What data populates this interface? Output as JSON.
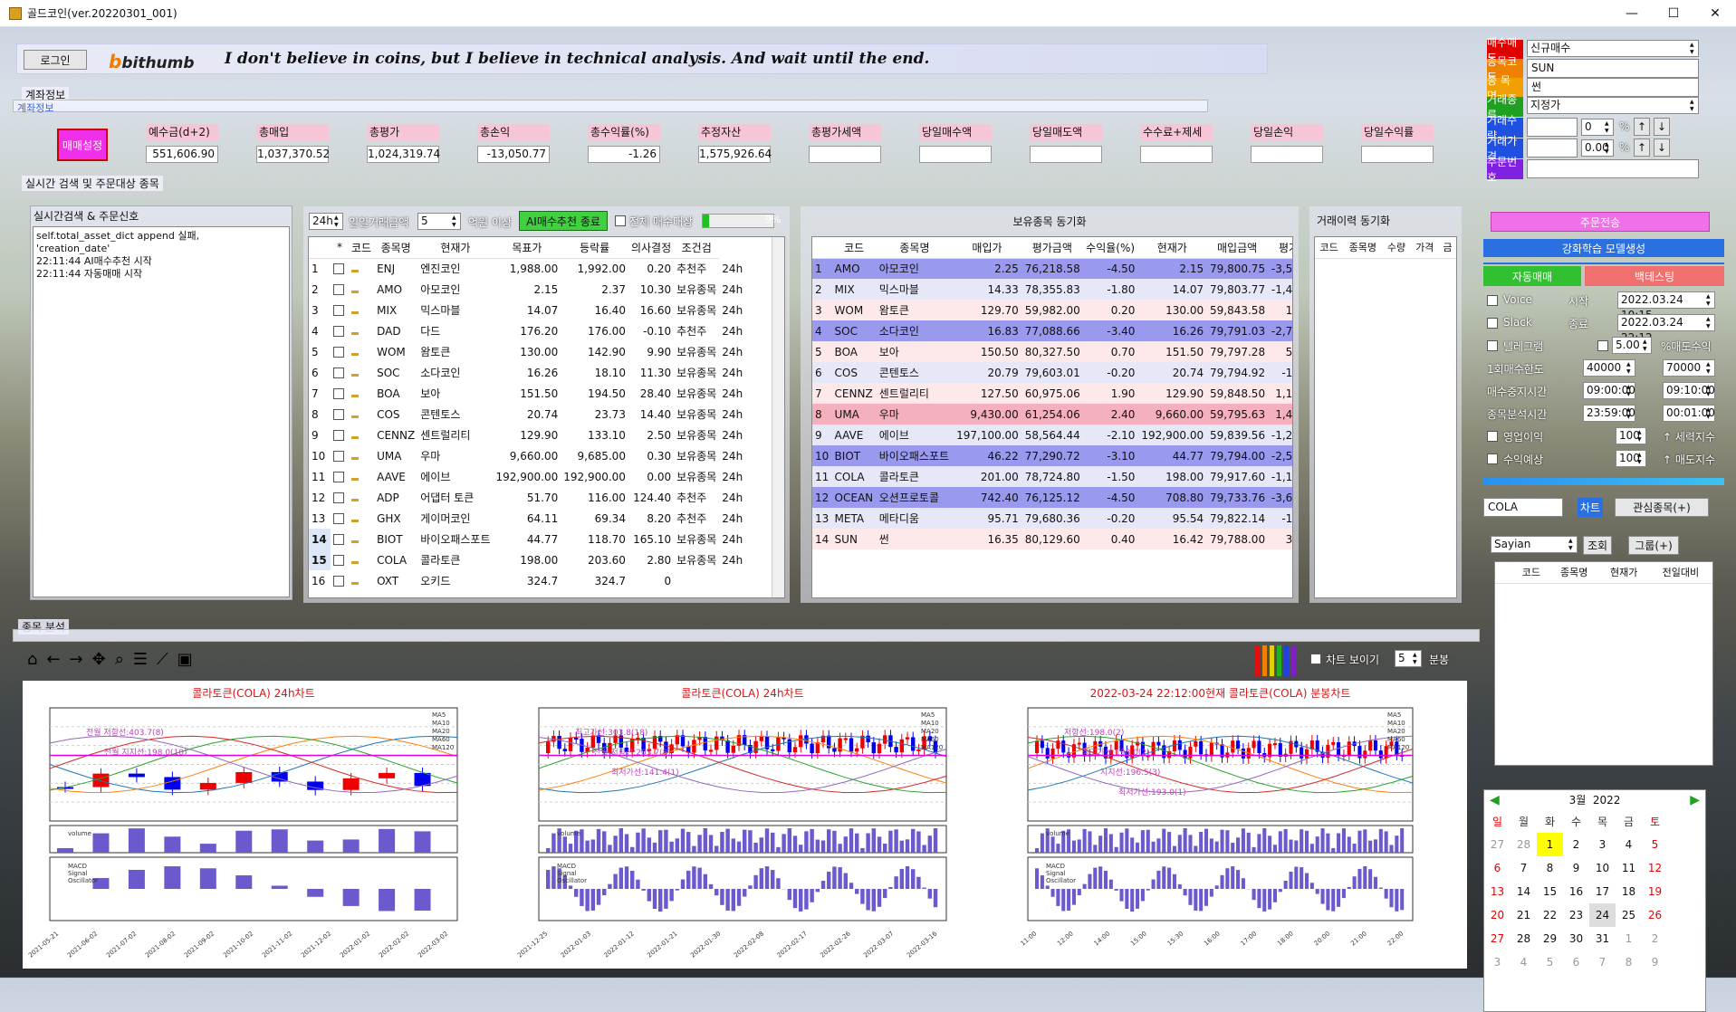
{
  "window": {
    "title": "골드코인(ver.20220301_001)",
    "min": "—",
    "max": "☐",
    "close": "✕"
  },
  "top": {
    "login": "로그인",
    "brand": "bithumb",
    "motto": "I don't believe in coins, but I believe in technical analysis. And wait until the end."
  },
  "account": {
    "section": "계좌정보",
    "section2": "계좌정보",
    "setting_btn": "매매설정",
    "labels": [
      "예수금(d+2)",
      "총매입",
      "총평가",
      "총손익",
      "총수익률(%)",
      "추정자산",
      "총평가세액",
      "당일매수액",
      "당일매도액",
      "수수료+제세",
      "당일손익",
      "당일수익률"
    ],
    "values": [
      "551,606.90",
      "1,037,370.52",
      "1,024,319.74",
      "-13,050.77",
      "-1.26",
      "1,575,926.64",
      "",
      "",
      "",
      "",
      "",
      ""
    ]
  },
  "search_section": "실시간 검색 및 주문대상 종목",
  "signal": {
    "title": "실시간검색 & 주문신호",
    "lines": [
      "self.total_asset_dict append 실패,",
      "'creation_date'",
      "22:11:44 AI매수추천 시작",
      "22:11:44 자동매매 시작"
    ]
  },
  "scan": {
    "period": "24h",
    "vol_label": "일일거래금액",
    "vol_value": "5",
    "unit": "억원 이상",
    "ai_btn": "AI매수추천 종료",
    "all_buy": "전체 매수대상",
    "progress": "9%",
    "headers": [
      "",
      "*",
      "코드",
      "종목명",
      "현재가",
      "목표가",
      "등락률",
      "의사결정",
      "조건검"
    ],
    "rows": [
      [
        "1",
        "ENJ",
        "엔진코인",
        "1,988.00",
        "1,992.00",
        "0.20",
        "추천주",
        "24h"
      ],
      [
        "2",
        "AMO",
        "아모코인",
        "2.15",
        "2.37",
        "10.30",
        "보유종목",
        "24h"
      ],
      [
        "3",
        "MIX",
        "믹스마블",
        "14.07",
        "16.40",
        "16.60",
        "보유종목",
        "24h"
      ],
      [
        "4",
        "DAD",
        "다드",
        "176.20",
        "176.00",
        "-0.10",
        "추천주",
        "24h"
      ],
      [
        "5",
        "WOM",
        "왐토큰",
        "130.00",
        "142.90",
        "9.90",
        "보유종목",
        "24h"
      ],
      [
        "6",
        "SOC",
        "소다코인",
        "16.26",
        "18.10",
        "11.30",
        "보유종목",
        "24h"
      ],
      [
        "7",
        "BOA",
        "보아",
        "151.50",
        "194.50",
        "28.40",
        "보유종목",
        "24h"
      ],
      [
        "8",
        "COS",
        "콘텐토스",
        "20.74",
        "23.73",
        "14.40",
        "보유종목",
        "24h"
      ],
      [
        "9",
        "CENNZ",
        "센트럴리티",
        "129.90",
        "133.10",
        "2.50",
        "보유종목",
        "24h"
      ],
      [
        "10",
        "UMA",
        "우마",
        "9,660.00",
        "9,685.00",
        "0.30",
        "보유종목",
        "24h"
      ],
      [
        "11",
        "AAVE",
        "에이브",
        "192,900.00",
        "192,900.00",
        "0.00",
        "보유종목",
        "24h"
      ],
      [
        "12",
        "ADP",
        "어댑터 토큰",
        "51.70",
        "116.00",
        "124.40",
        "추천주",
        "24h"
      ],
      [
        "13",
        "GHX",
        "게이머코인",
        "64.11",
        "69.34",
        "8.20",
        "추천주",
        "24h"
      ],
      [
        "14",
        "BIOT",
        "바이오패스포트",
        "44.77",
        "118.70",
        "165.10",
        "보유종목",
        "24h"
      ],
      [
        "15",
        "COLA",
        "콜라토큰",
        "198.00",
        "203.60",
        "2.80",
        "보유종목",
        "24h"
      ],
      [
        "16",
        "OXT",
        "오키드",
        "324.7",
        "324.7",
        "0",
        "",
        " "
      ]
    ]
  },
  "holdings": {
    "title": "보유종목 동기화",
    "headers": [
      "",
      "코드",
      "종목명",
      "매입가",
      "평가금액",
      "수익율(%)",
      "현재가",
      "매입금액",
      "평가손"
    ],
    "rows": [
      [
        "1",
        "AMO",
        "아모코인",
        "2.25",
        "76,218.58",
        "-4.50",
        "2.15",
        "79,800.75",
        "-3,582.1",
        "b"
      ],
      [
        "2",
        "MIX",
        "믹스마블",
        "14.33",
        "78,355.83",
        "-1.80",
        "14.07",
        "79,803.77",
        "-1,447.9",
        "l"
      ],
      [
        "3",
        "WOM",
        "왐토큰",
        "129.70",
        "59,982.00",
        "0.20",
        "130.00",
        "59,843.58",
        "138.4",
        "p"
      ],
      [
        "4",
        "SOC",
        "소다코인",
        "16.83",
        "77,088.66",
        "-3.40",
        "16.26",
        "79,791.03",
        "-2,702.3",
        "b"
      ],
      [
        "5",
        "BOA",
        "보아",
        "150.50",
        "80,327.50",
        "0.70",
        "151.50",
        "79,797.28",
        "530.2",
        "p"
      ],
      [
        "6",
        "COS",
        "콘텐토스",
        "20.79",
        "79,603.01",
        "-0.20",
        "20.74",
        "79,794.92",
        "-191.9",
        "l"
      ],
      [
        "7",
        "CENNZ",
        "센트럴리티",
        "127.50",
        "60,975.06",
        "1.90",
        "129.90",
        "59,848.50",
        "1,126.5",
        "p"
      ],
      [
        "8",
        "UMA",
        "우마",
        "9,430.00",
        "61,254.06",
        "2.40",
        "9,660.00",
        "59,795.63",
        "1,458.4",
        "k"
      ],
      [
        "9",
        "AAVE",
        "에이브",
        "197,100.00",
        "58,564.44",
        "-2.10",
        "192,900.00",
        "59,839.56",
        "-1,275.1",
        "l"
      ],
      [
        "10",
        "BIOT",
        "바이오패스포트",
        "46.22",
        "77,290.72",
        "-3.10",
        "44.77",
        "79,794.00",
        "-2,503.2",
        "b"
      ],
      [
        "11",
        "COLA",
        "콜라토큰",
        "201.00",
        "78,724.80",
        "-1.50",
        "198.00",
        "79,917.60",
        "-1,192.8",
        "l"
      ],
      [
        "12",
        "OCEAN",
        "오션프로토콜",
        "742.40",
        "76,125.12",
        "-4.50",
        "708.80",
        "79,733.76",
        "-3,608.6",
        "b"
      ],
      [
        "13",
        "META",
        "메타디움",
        "95.71",
        "79,680.36",
        "-0.20",
        "95.54",
        "79,822.14",
        "-141.7",
        "l"
      ],
      [
        "14",
        "SUN",
        "썬",
        "16.35",
        "80,129.60",
        "0.40",
        "16.42",
        "79,788.00",
        "341.6",
        "p"
      ]
    ]
  },
  "history": {
    "title": "거래이력 동기화",
    "headers": [
      "코드",
      "종목명",
      "수량",
      "가격",
      "금"
    ]
  },
  "order": {
    "labels": [
      "매수매도",
      "종목코드",
      "종 목 명",
      "거래종류",
      "거래수량",
      "거래가격",
      "주문번호"
    ],
    "label_colors": [
      "#e00000",
      "#f08000",
      "#f0a000",
      "#20a020",
      "#2050e0",
      "#2050e0",
      "#8020e0"
    ],
    "buysell": "신규매수",
    "code": "SUN",
    "name": "썬",
    "type": "지정가",
    "qty": "0",
    "price": "0.00",
    "pct": "%",
    "order_btn": "주문전송",
    "rl_btn": "강화학습 모델생성",
    "auto_btn": "자동매매",
    "backtest_btn": "백테스팅",
    "voice": "Voice",
    "start_lbl": "시작",
    "start": "2022.03.24 10:15",
    "slack": "Slack",
    "end_lbl": "종료",
    "end": "2022.03.24 22:12",
    "telegram": "텔레그램",
    "buy_pct": "5.00",
    "buy_pct_lbl": "%매도수익",
    "once_lbl": "1회매수한도",
    "once1": "40000",
    "once2": "70000",
    "stop_lbl": "매수중지시간",
    "stop1": "09:00:00",
    "stop2": "09:10:00",
    "anal_lbl": "종목분석시간",
    "anal1": "23:59:00",
    "anal2": "00:01:00",
    "biz_lbl": "영업이익",
    "biz_val": "100",
    "biz_sfx": "↑ 세력지수",
    "roe_lbl": "수익예상",
    "roe_val": "100",
    "roe_sfx": "↑ 매도지수",
    "chart_code": "COLA",
    "chart_btn": "차트",
    "fav_btn": "관심종목(+)",
    "group_sel": "Sayian",
    "query_btn": "조회",
    "group_btn": "그룹(+)",
    "fav_headers": [
      "코드",
      "종목명",
      "현재가",
      "전일대비"
    ]
  },
  "calendar": {
    "month": "3월",
    "year": "2022",
    "days": [
      "일",
      "월",
      "화",
      "수",
      "목",
      "금",
      "토"
    ],
    "weeks": [
      [
        "27",
        "28",
        "1",
        "2",
        "3",
        "4",
        "5"
      ],
      [
        "6",
        "7",
        "8",
        "9",
        "10",
        "11",
        "12"
      ],
      [
        "13",
        "14",
        "15",
        "16",
        "17",
        "18",
        "19"
      ],
      [
        "20",
        "21",
        "22",
        "23",
        "24",
        "25",
        "26"
      ],
      [
        "27",
        "28",
        "29",
        "30",
        "31",
        "1",
        "2"
      ],
      [
        "3",
        "4",
        "5",
        "6",
        "7",
        "8",
        "9"
      ]
    ]
  },
  "analysis": {
    "section": "종목 분석",
    "show_chart": "차트 보이기",
    "minutes": "5",
    "minutes_lbl": "분봉"
  },
  "chart_data": [
    {
      "type": "candlestick",
      "title": "콜라토큰(COLA) 24h차트",
      "x": [
        "2021-05-21",
        "2021-06-02",
        "2021-07-02",
        "2021-08-02",
        "2021-09-02",
        "2021-10-02",
        "2021-11-02",
        "2021-12-02",
        "2022-01-02",
        "2022-02-02",
        "2022-03-02"
      ],
      "ylim": [
        0,
        2700
      ],
      "legend": [
        "MA5",
        "MA10",
        "MA20",
        "MA60",
        "MA120"
      ],
      "annotations": [
        "전월 저항선:403.7(8)",
        "전월 지지선:198.0(10)"
      ],
      "sub": [
        "volume",
        "MACD",
        "Signal",
        "Oscillator"
      ]
    },
    {
      "type": "candlestick",
      "title": "콜라토큰(COLA) 24h차트",
      "x": [
        "2021-12-25",
        "2022-01-03",
        "2022-01-12",
        "2022-01-21",
        "2022-01-30",
        "2022-02-08",
        "2022-02-17",
        "2022-02-26",
        "2022-03-07",
        "2022-03-16"
      ],
      "ylim": [
        130,
        410
      ],
      "legend": [
        "MA5",
        "MA10",
        "MA20",
        "MA60",
        "MA120"
      ],
      "annotations": [
        "최고가선:303.8(18)",
        "전월 저항선:203.7(8)",
        "최저가선:141.4(1)"
      ],
      "sub": [
        "volume",
        "MACD",
        "Signal",
        "Oscillator"
      ]
    },
    {
      "type": "candlestick",
      "title": "2022-03-24 22:12:00현재 콜라토큰(COLA) 분봉차트",
      "x": [
        "11:00",
        "12:00",
        "14:00",
        "15:00",
        "15:30",
        "16:00",
        "17:00",
        "18:00",
        "20:00",
        "21:00",
        "22:00"
      ],
      "ylim": [
        193,
        198.5
      ],
      "legend": [
        "MA5",
        "MA10",
        "MA20",
        "MA60",
        "MA120"
      ],
      "annotations": [
        "저항선:198.0(2)",
        "최고가선:198.0(2)",
        "지지선:196.5(3)",
        "최저가선:193.0(1)"
      ],
      "sub": [
        "volume",
        "MACD",
        "Signal",
        "Oscillator"
      ]
    }
  ]
}
